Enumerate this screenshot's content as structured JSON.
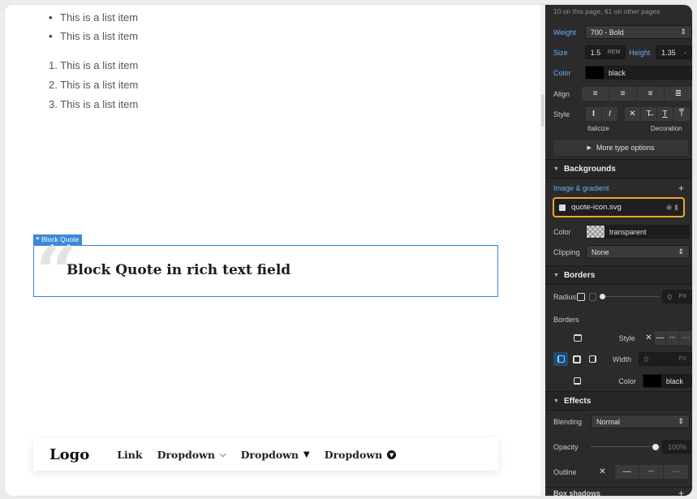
{
  "canvas": {
    "bullet_items": [
      "This is a list item",
      "This is a list item"
    ],
    "numbered_items": [
      "1. This is a list item",
      "2. This is a list item",
      "3. This is a list item"
    ],
    "blockquote_tag": "Block Quote",
    "blockquote_text": "Block Quote in rich text field",
    "navbar": {
      "logo": "Logo",
      "link": "Link",
      "dropdown1": "Dropdown",
      "dropdown2": "Dropdown",
      "dropdown3": "Dropdown"
    }
  },
  "panel": {
    "top_note": "10 on this page, 61 on other pages",
    "typography": {
      "weight_label": "Weight",
      "weight_value": "700 - Bold",
      "size_label": "Size",
      "size_value": "1.5",
      "size_unit": "REM",
      "height_label": "Height",
      "height_value": "1.35",
      "height_unit": "-",
      "color_label": "Color",
      "color_value": "black",
      "align_label": "Align",
      "style_label": "Style",
      "italicize_label": "Italicize",
      "decoration_label": "Decoration",
      "more_options": "More type options"
    },
    "backgrounds": {
      "title": "Backgrounds",
      "image_gradient_label": "Image & gradient",
      "image_file": "quote-icon.svg",
      "color_label": "Color",
      "color_value": "transparent",
      "clipping_label": "Clipping",
      "clipping_value": "None"
    },
    "borders": {
      "title": "Borders",
      "radius_label": "Radius",
      "radius_value": "0",
      "radius_unit": "PX",
      "borders_label": "Borders",
      "style_label": "Style",
      "width_label": "Width",
      "width_value": "0",
      "width_unit": "PX",
      "color_label": "Color",
      "color_value": "black"
    },
    "effects": {
      "title": "Effects",
      "blending_label": "Blending",
      "blending_value": "Normal",
      "opacity_label": "Opacity",
      "opacity_value": "100",
      "opacity_unit": "%",
      "outline_label": "Outline",
      "box_shadows_label": "Box shadows"
    },
    "colors": {
      "accent": "#3b89d6",
      "highlight": "#f0a530"
    }
  }
}
